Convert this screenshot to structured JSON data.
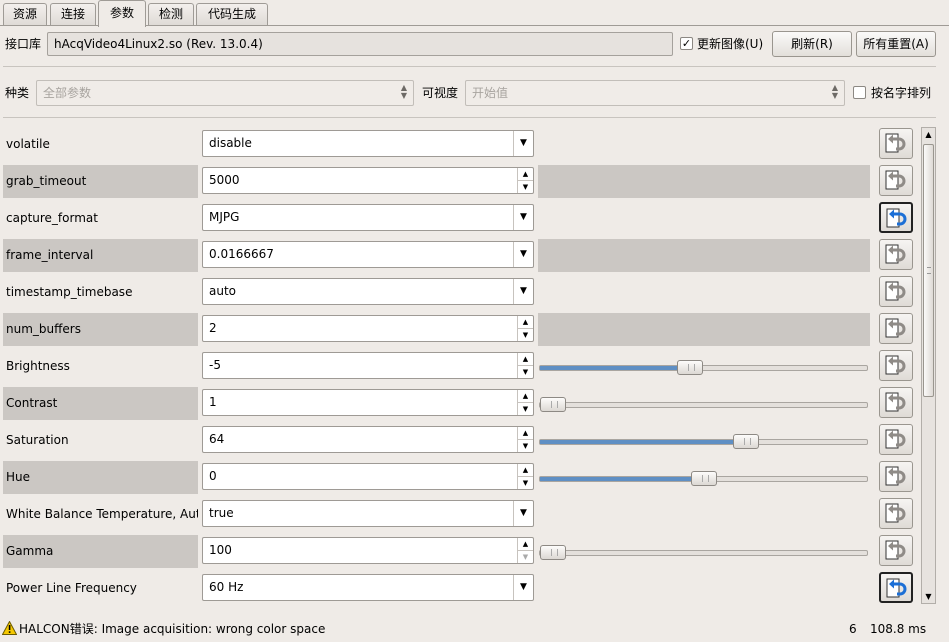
{
  "tabs": [
    "资源",
    "连接",
    "参数",
    "检测",
    "代码生成"
  ],
  "active_tab_index": 2,
  "interface": {
    "label": "接口库",
    "value": "hAcqVideo4Linux2.so (Rev. 13.0.4)",
    "update_image_label": "更新图像(U)",
    "update_image_checked": true,
    "refresh_label": "刷新(R)",
    "reset_all_label": "所有重置(A)"
  },
  "filters": {
    "category_label": "种类",
    "category_value": "全部参数",
    "visibility_label": "可视度",
    "visibility_value": "开始值",
    "sort_by_name_label": "按名字排列",
    "sort_by_name_checked": false
  },
  "params": [
    {
      "name": "volatile",
      "value": "disable",
      "control": "dropdown",
      "reset_active": false
    },
    {
      "name": "grab_timeout",
      "value": "5000",
      "control": "spin",
      "reset_active": false
    },
    {
      "name": "capture_format",
      "value": "MJPG",
      "control": "dropdown",
      "reset_active": true
    },
    {
      "name": "frame_interval",
      "value": "0.0166667",
      "control": "dropdown",
      "reset_active": false
    },
    {
      "name": "timestamp_timebase",
      "value": "auto",
      "control": "dropdown",
      "reset_active": false
    },
    {
      "name": "num_buffers",
      "value": "2",
      "control": "spin",
      "reset_active": false
    },
    {
      "name": "Brightness",
      "value": "-5",
      "control": "spin",
      "slider": 0.46,
      "reset_active": false
    },
    {
      "name": "Contrast",
      "value": "1",
      "control": "spin",
      "slider": 0.04,
      "reset_active": false
    },
    {
      "name": "Saturation",
      "value": "64",
      "control": "spin",
      "slider": 0.63,
      "reset_active": false
    },
    {
      "name": "Hue",
      "value": "0",
      "control": "spin",
      "slider": 0.5,
      "reset_active": false
    },
    {
      "name": "White Balance Temperature, Auto",
      "value": "true",
      "control": "dropdown",
      "reset_active": false
    },
    {
      "name": "Gamma",
      "value": "100",
      "control": "spin",
      "slider": 0.0,
      "reset_active": false
    },
    {
      "name": "Power Line Frequency",
      "value": "60 Hz",
      "control": "dropdown",
      "reset_active": true
    }
  ],
  "status": {
    "message": "HALCON错误: Image acquisition: wrong color space",
    "count": "6",
    "time": "108.8 ms"
  },
  "colors": {
    "shade": "#cbc7c3",
    "slider_fill": "#5f8fc4",
    "reset_arrow_active": "#1c6fd6",
    "reset_arrow_inactive": "#8f8b87"
  }
}
